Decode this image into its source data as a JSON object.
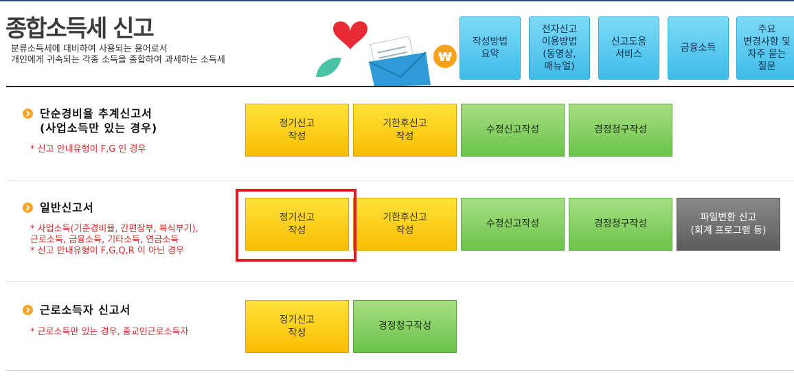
{
  "header": {
    "title": "종합소득세 신고",
    "desc_line1": "분류소득세에 대비하여 사용되는 용어로서",
    "desc_line2": "개인에게 귀속되는 각종 소득을 종합하여 과세하는 소득세"
  },
  "help_buttons": [
    {
      "label": "작성방법\n요약"
    },
    {
      "label": "전자신고\n이용방법\n(동영상,\n매뉴얼)"
    },
    {
      "label": "신고도움\n서비스"
    },
    {
      "label": "금융소득"
    },
    {
      "label": "주요\n변경사항 및\n자주 묻는\n질문"
    }
  ],
  "sections": [
    {
      "title": "단순경비율 추계신고서\n(사업소득만 있는 경우)",
      "notes": "* 신고 안내유형이 F,G 인 경우",
      "buttons": [
        "정기신고\n작성",
        "기한후신고\n작성",
        "수정신고작성",
        "경정청구작성"
      ]
    },
    {
      "title": "일반신고서",
      "notes": "* 사업소득(기준경비율, 간편장부, 복식부기),\n   근로소득, 금융소득, 기타소득, 연금소득\n* 신고 안내유형이 F,G,Q,R 이 아닌 경우",
      "buttons": [
        "정기신고\n작성",
        "기한후신고\n작성",
        "수정신고작성",
        "경정청구작성",
        "파일변환 신고\n(회계 프로그램 등)"
      ]
    },
    {
      "title": "근로소득자 신고서",
      "notes": "* 근로소득만 있는 경우, 종교인근로소득자",
      "buttons": [
        "정기신고\n작성",
        "경정청구작성"
      ]
    }
  ],
  "colors": {
    "yellow_button": "#fcd01a",
    "green_button": "#86d166",
    "gray_button": "#707070",
    "help_button": "#5ccdef",
    "note_text": "#d42a2a",
    "highlight_border": "#e2191e",
    "section_bullet": "#f7a52a"
  },
  "icons": {
    "illustration": "envelope-heart-won-illustration",
    "section_bullet": "chevron-right-icon"
  }
}
